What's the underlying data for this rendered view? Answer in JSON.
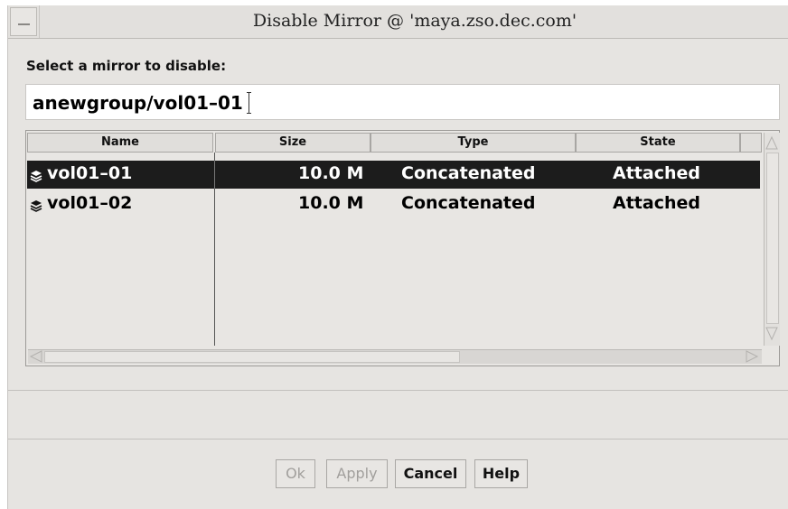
{
  "window": {
    "title": "Disable Mirror @ 'maya.zso.dec.com'"
  },
  "prompt": {
    "label": "Select a mirror to disable:"
  },
  "selection_field": {
    "value": "anewgroup/vol01–01"
  },
  "table": {
    "columns": [
      "Name",
      "Size",
      "Type",
      "State"
    ],
    "rows": [
      {
        "name": "vol01–01",
        "size": "10.0 M",
        "type": "Concatenated",
        "state": "Attached",
        "selected": true
      },
      {
        "name": "vol01–02",
        "size": "10.0 M",
        "type": "Concatenated",
        "state": "Attached",
        "selected": false
      }
    ]
  },
  "buttons": {
    "ok": "Ok",
    "apply": "Apply",
    "cancel": "Cancel",
    "help": "Help"
  },
  "icons": {
    "window_menu": "window-menu-icon",
    "row_icon": "volume-icon",
    "scroll_up": "arrow-up-icon",
    "scroll_down": "arrow-down-icon",
    "scroll_left": "arrow-left-icon",
    "scroll_right": "arrow-right-icon"
  },
  "colors": {
    "selected_row_bg": "#1c1c1c",
    "selected_row_fg": "#ffffff",
    "window_bg": "#e6e4e1"
  }
}
